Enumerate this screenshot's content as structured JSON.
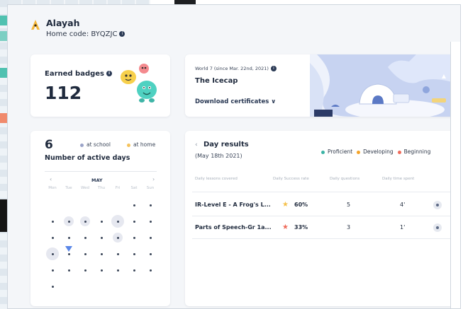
{
  "user": {
    "name": "Alayah",
    "home_code_label": "Home code: BYQZJC"
  },
  "badges": {
    "label": "Earned badges",
    "count": "112"
  },
  "world": {
    "subtitle": "World 7 (since Mar. 22nd, 2021)",
    "title": "The Icecap",
    "download_label": "Download certificates ∨"
  },
  "activity": {
    "days_count": "6",
    "days_label": "Number of active days",
    "legend_school": "at school",
    "legend_home": "at home",
    "school_color": "#9aa3c8",
    "home_color": "#f5c25b"
  },
  "calendar": {
    "prev": "‹",
    "next": "›",
    "month": "MAY",
    "weekdays": [
      "Mon",
      "Tue",
      "Wed",
      "Thu",
      "Fri",
      "Sat",
      "Sun"
    ]
  },
  "results": {
    "back": "‹",
    "title": "Day results",
    "date": "(May 18th 2021)",
    "legend": [
      {
        "label": "Proficient",
        "color": "#3bb3a5"
      },
      {
        "label": "Developing",
        "color": "#f4a42a"
      },
      {
        "label": "Beginning",
        "color": "#ef6b5b"
      }
    ],
    "columns": {
      "lessons": "Daily lessons covered",
      "success": "Daily Success rate",
      "questions": "Daily questions",
      "time": "Daily time spent"
    },
    "rows": [
      {
        "lesson": "IR-Level E - A Frog's L...",
        "rate": "60%",
        "star_color": "#f5c04a",
        "questions": "5",
        "time": "4'"
      },
      {
        "lesson": "Parts of Speech-Gr 1a...",
        "rate": "33%",
        "star_color": "#ef6b5b",
        "questions": "3",
        "time": "1'"
      }
    ]
  }
}
